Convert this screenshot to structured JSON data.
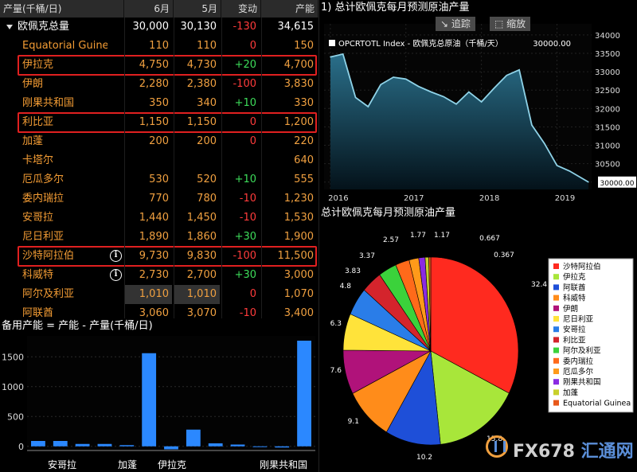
{
  "table": {
    "headers": [
      "产量(千桶/日)",
      "6月",
      "5月",
      "变动",
      "产能"
    ],
    "rows": [
      {
        "name": "欧佩克总量",
        "jun": "30,000",
        "may": "30,130",
        "chg": "-130",
        "cap": "34,615",
        "total": true
      },
      {
        "name": "Equatorial Guine",
        "jun": "110",
        "may": "110",
        "chg": "0",
        "cap": "150"
      },
      {
        "name": "伊拉克",
        "jun": "4,750",
        "may": "4,730",
        "chg": "+20",
        "cap": "4,700",
        "highlight": true
      },
      {
        "name": "伊朗",
        "jun": "2,280",
        "may": "2,380",
        "chg": "-100",
        "cap": "3,830"
      },
      {
        "name": "刚果共和国",
        "jun": "350",
        "may": "340",
        "chg": "+10",
        "cap": "330"
      },
      {
        "name": "利比亚",
        "jun": "1,150",
        "may": "1,150",
        "chg": "0",
        "cap": "1,200",
        "highlight": true
      },
      {
        "name": "加蓬",
        "jun": "200",
        "may": "200",
        "chg": "0",
        "cap": "220"
      },
      {
        "name": "卡塔尔",
        "jun": "",
        "may": "",
        "chg": "",
        "cap": "640"
      },
      {
        "name": "厄瓜多尔",
        "jun": "530",
        "may": "520",
        "chg": "+10",
        "cap": "555"
      },
      {
        "name": "委内瑞拉",
        "jun": "770",
        "may": "780",
        "chg": "-10",
        "cap": "1,230"
      },
      {
        "name": "安哥拉",
        "jun": "1,440",
        "may": "1,450",
        "chg": "-10",
        "cap": "1,530"
      },
      {
        "name": "尼日利亚",
        "jun": "1,890",
        "may": "1,860",
        "chg": "+30",
        "cap": "1,900"
      },
      {
        "name": "沙特阿拉伯",
        "jun": "9,730",
        "may": "9,830",
        "chg": "-100",
        "cap": "11,500",
        "highlight": true,
        "info": "i"
      },
      {
        "name": "科威特",
        "jun": "2,730",
        "may": "2,700",
        "chg": "+30",
        "cap": "3,000",
        "info": "i"
      },
      {
        "name": "阿尔及利亚",
        "jun": "1,010",
        "may": "1,010",
        "chg": "0",
        "cap": "1,070",
        "shaded": true
      },
      {
        "name": "阿联酋",
        "jun": "3,060",
        "may": "3,070",
        "chg": "-10",
        "cap": "3,400"
      }
    ]
  },
  "line_panel": {
    "title": "1) 总计欧佩克每月预测原油产量",
    "buttons": [
      "追踪",
      "缩放"
    ],
    "legend_label": "OPCRTOTL Index - 欧佩克总原油（千桶/天）",
    "legend_value": "30000.00",
    "last_value_label": "30000.00"
  },
  "pie_panel": {
    "title": "总计欧佩克每月预测原油产量"
  },
  "bar_panel": {
    "title": "备用产能 = 产能 - 产量(千桶/日)"
  },
  "logo": {
    "text_a": "FX678",
    "text_b": " 汇通网"
  },
  "chart_data": [
    {
      "type": "area",
      "name": "line",
      "x": [
        "2016-01",
        "2016-03",
        "2016-05",
        "2016-07",
        "2016-09",
        "2016-11",
        "2017-01",
        "2017-03",
        "2017-05",
        "2017-07",
        "2017-09",
        "2017-11",
        "2018-01",
        "2018-03",
        "2018-05",
        "2018-07",
        "2018-09",
        "2018-11",
        "2019-01",
        "2019-03",
        "2019-06"
      ],
      "y": [
        33400,
        33480,
        32300,
        32050,
        32650,
        32850,
        32800,
        32600,
        32450,
        32320,
        32120,
        32450,
        32180,
        32550,
        32900,
        33050,
        31550,
        31050,
        30450,
        30300,
        30000
      ],
      "x_tick_labels": [
        "2016",
        "2017",
        "2018",
        "2019"
      ],
      "y_tick_labels": [
        "34000",
        "33500",
        "33000",
        "32500",
        "32000",
        "31500",
        "31000",
        "30500",
        "30000"
      ],
      "ylim": [
        29800,
        34300
      ],
      "series_color": "#8fd3e8"
    },
    {
      "type": "bar",
      "name": "bars",
      "categories": [
        "安哥拉",
        "",
        "加蓬",
        "",
        "伊拉克",
        "",
        "",
        "",
        "刚果共和国",
        ""
      ],
      "category_labels_visible": [
        "安哥拉",
        "加蓬",
        "伊拉克",
        "刚果共和国"
      ],
      "values": [
        90,
        90,
        40,
        40,
        20,
        1560,
        -50,
        280,
        50,
        30,
        0,
        -20,
        1770
      ],
      "y_tick_labels": [
        "1500",
        "1000",
        "500",
        "0"
      ],
      "ylim": [
        -70,
        1850
      ],
      "bar_color": "#2b88ff"
    },
    {
      "type": "pie",
      "name": "pie",
      "labels": [
        "沙特阿拉伯",
        "伊拉克",
        "阿联酋",
        "科威特",
        "伊朗",
        "尼日利亚",
        "安哥拉",
        "利比亚",
        "阿尔及利亚",
        "委内瑞拉",
        "厄瓜多尔",
        "刚果共和国",
        "加蓬",
        "Equatorial Guinea"
      ],
      "values": [
        32.4,
        15.8,
        10.2,
        9.1,
        7.6,
        6.3,
        4.8,
        3.83,
        3.37,
        2.57,
        1.77,
        1.17,
        0.667,
        0.367
      ],
      "value_labels": [
        "32.4",
        "15.8",
        "10.2",
        "9.1",
        "7.6",
        "6.3",
        "4.8",
        "3.83",
        "3.37",
        "2.57",
        "1.77",
        "1.17",
        "0.667",
        "0.367"
      ],
      "colors": [
        "#ff2a1f",
        "#a8e63a",
        "#1e4fd8",
        "#ff8c1a",
        "#b0127a",
        "#ffe33a",
        "#2a7de8",
        "#d4242c",
        "#3bd23b",
        "#ff6a1a",
        "#ff9a1a",
        "#8a2be2",
        "#c8d02a",
        "#e8581a"
      ]
    }
  ]
}
